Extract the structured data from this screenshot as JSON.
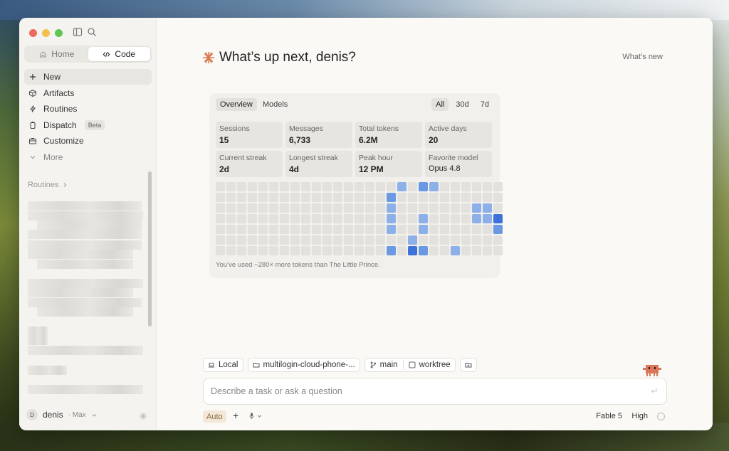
{
  "sidebar": {
    "segment": {
      "home": "Home",
      "code": "Code",
      "active": "code"
    },
    "nav": [
      {
        "label": "New",
        "icon": "plus-icon",
        "active": true
      },
      {
        "label": "Artifacts",
        "icon": "artifacts-icon"
      },
      {
        "label": "Routines",
        "icon": "routines-icon"
      },
      {
        "label": "Dispatch",
        "icon": "dispatch-icon",
        "badge": "Beta"
      },
      {
        "label": "Customize",
        "icon": "briefcase-icon"
      },
      {
        "label": "More",
        "icon": "chevron-down-icon",
        "muted": true
      }
    ],
    "routines_header": "Routines",
    "user": {
      "initial": "D",
      "name": "denis",
      "plan": "· Max"
    }
  },
  "main": {
    "greeting": "What’s up next, denis?",
    "whats_new": "What’s new",
    "card": {
      "tabs": [
        "Overview",
        "Models"
      ],
      "active_tab": "Overview",
      "ranges": [
        "All",
        "30d",
        "7d"
      ],
      "active_range": "All",
      "stats": [
        {
          "label": "Sessions",
          "value": "15"
        },
        {
          "label": "Messages",
          "value": "6,733"
        },
        {
          "label": "Total tokens",
          "value": "6.2M"
        },
        {
          "label": "Active days",
          "value": "20"
        },
        {
          "label": "Current streak",
          "value": "2d"
        },
        {
          "label": "Longest streak",
          "value": "4d"
        },
        {
          "label": "Peak hour",
          "value": "12 PM"
        },
        {
          "label": "Favorite model",
          "value": "Opus 4.8"
        }
      ],
      "activity_levels": [
        [
          0,
          0,
          0,
          0,
          0,
          0,
          0,
          0,
          0,
          0,
          0,
          0,
          0,
          0,
          0,
          0,
          0,
          2,
          0,
          3,
          2,
          0,
          0,
          0,
          0,
          0,
          0
        ],
        [
          0,
          0,
          0,
          0,
          0,
          0,
          0,
          0,
          0,
          0,
          0,
          0,
          0,
          0,
          0,
          0,
          3,
          0,
          0,
          0,
          0,
          0,
          0,
          0,
          0,
          0,
          0
        ],
        [
          0,
          0,
          0,
          0,
          0,
          0,
          0,
          0,
          0,
          0,
          0,
          0,
          0,
          0,
          0,
          0,
          2,
          0,
          0,
          0,
          0,
          0,
          0,
          0,
          2,
          2,
          0
        ],
        [
          0,
          0,
          0,
          0,
          0,
          0,
          0,
          0,
          0,
          0,
          0,
          0,
          0,
          0,
          0,
          0,
          2,
          0,
          0,
          2,
          0,
          0,
          0,
          0,
          2,
          2,
          4
        ],
        [
          0,
          0,
          0,
          0,
          0,
          0,
          0,
          0,
          0,
          0,
          0,
          0,
          0,
          0,
          0,
          0,
          2,
          0,
          0,
          2,
          0,
          0,
          0,
          0,
          0,
          0,
          3
        ],
        [
          0,
          0,
          0,
          0,
          0,
          0,
          0,
          0,
          0,
          0,
          0,
          0,
          0,
          0,
          0,
          0,
          0,
          0,
          2,
          0,
          0,
          0,
          0,
          0,
          0,
          0,
          0
        ],
        [
          0,
          0,
          0,
          0,
          0,
          0,
          0,
          0,
          0,
          0,
          0,
          0,
          0,
          0,
          0,
          0,
          3,
          0,
          4,
          3,
          0,
          0,
          2,
          0,
          0,
          0,
          0
        ]
      ],
      "footer": "You’ve used ~280× more tokens than The Little Prince."
    },
    "chips": {
      "env": "Local",
      "repo": "multilogin-cloud-phone-...",
      "branch": "main",
      "worktree": "worktree"
    },
    "input": {
      "placeholder": "Describe a task or ask a question",
      "value": ""
    },
    "bottom": {
      "mode": "Auto",
      "model": "Fable 5",
      "effort": "High"
    }
  }
}
